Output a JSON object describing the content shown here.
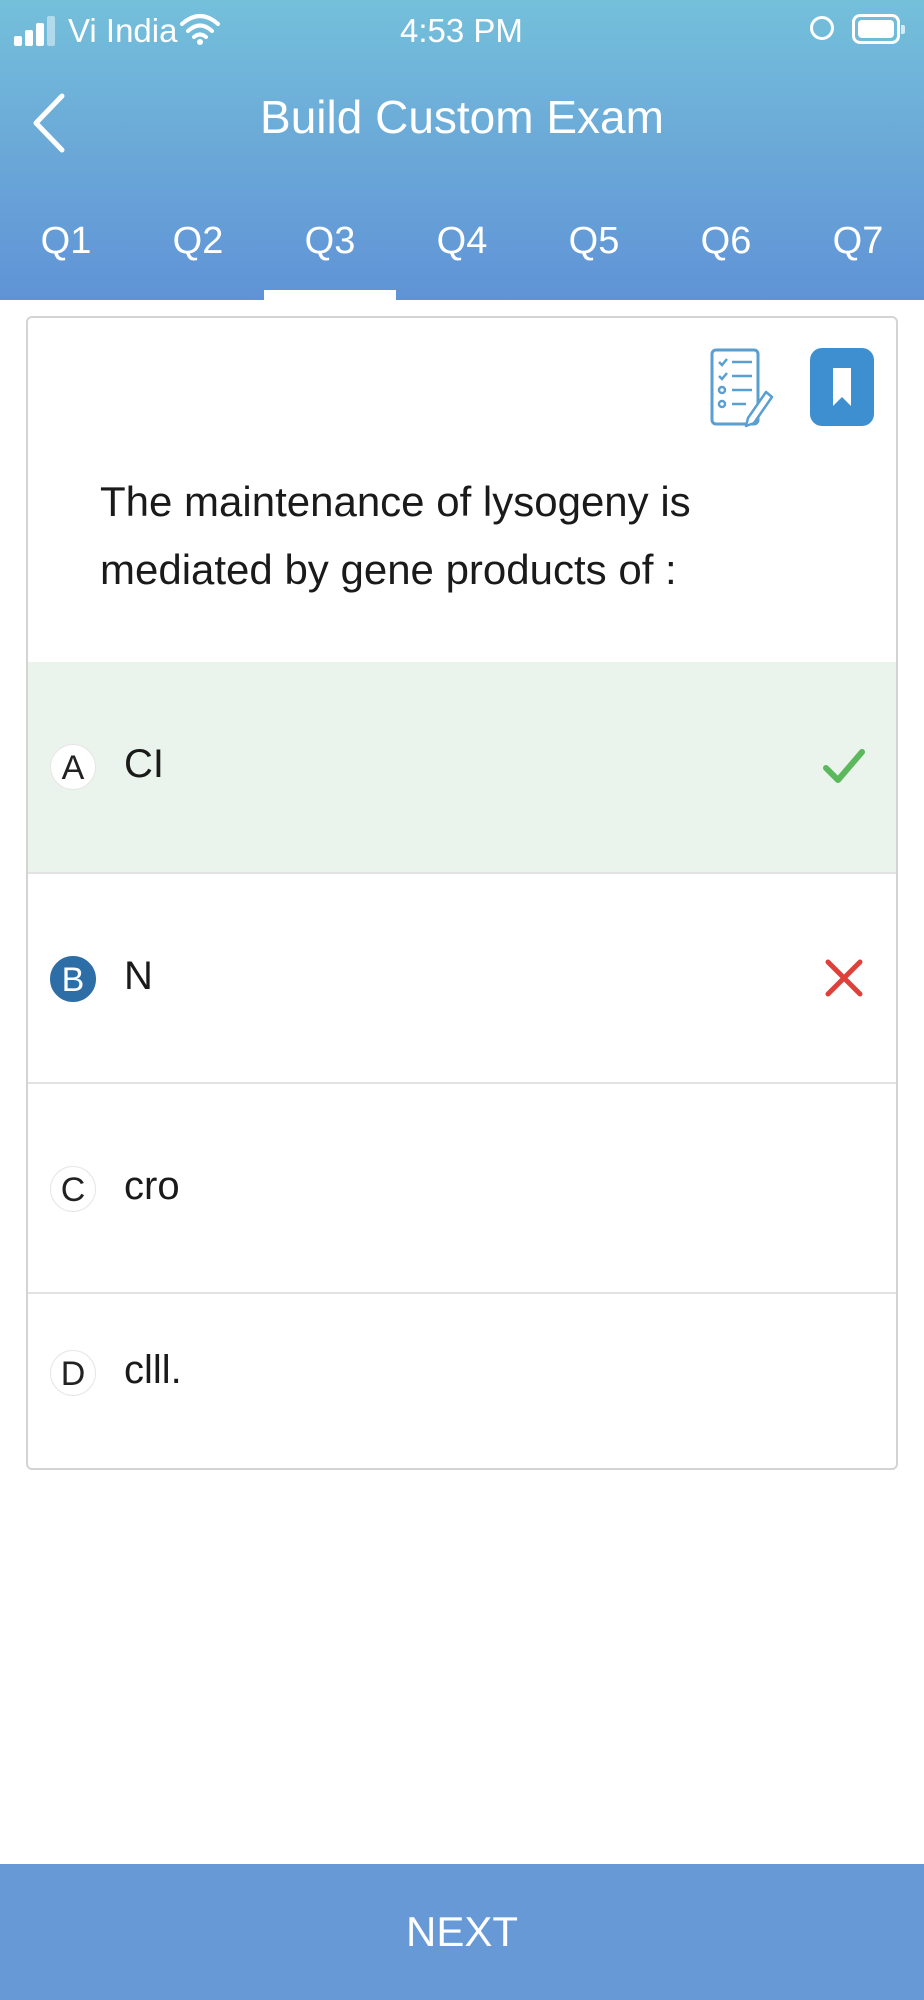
{
  "status_bar": {
    "carrier": "Vi India",
    "time": "4:53 PM"
  },
  "header": {
    "title": "Build Custom Exam"
  },
  "tabs": [
    {
      "label": "Q1"
    },
    {
      "label": "Q2"
    },
    {
      "label": "Q3"
    },
    {
      "label": "Q4"
    },
    {
      "label": "Q5"
    },
    {
      "label": "Q6"
    },
    {
      "label": "Q7"
    }
  ],
  "active_tab": "Q3",
  "question": {
    "text": "The maintenance of lysogeny is mediated by gene products of :",
    "options": [
      {
        "letter": "A",
        "text": "CI",
        "state": "correct"
      },
      {
        "letter": "B",
        "text": "N",
        "state": "selected-wrong"
      },
      {
        "letter": "C",
        "text": "cro",
        "state": "none"
      },
      {
        "letter": "D",
        "text": "clll.",
        "state": "none"
      }
    ]
  },
  "footer": {
    "next_label": "NEXT"
  },
  "colors": {
    "header_top": "#74c0db",
    "header_bottom": "#5f93d6",
    "correct_bg": "#eaf4ec",
    "correct_mark": "#5cb85c",
    "wrong_mark": "#e0403a",
    "selected_letter": "#2e6ea6",
    "bookmark": "#3d8fd0",
    "next_bar": "#6699d6"
  },
  "icons": {
    "back": "chevron-left-icon",
    "notes": "checklist-pencil-icon",
    "bookmark": "bookmark-icon",
    "correct": "checkmark-icon",
    "wrong": "cross-icon"
  }
}
